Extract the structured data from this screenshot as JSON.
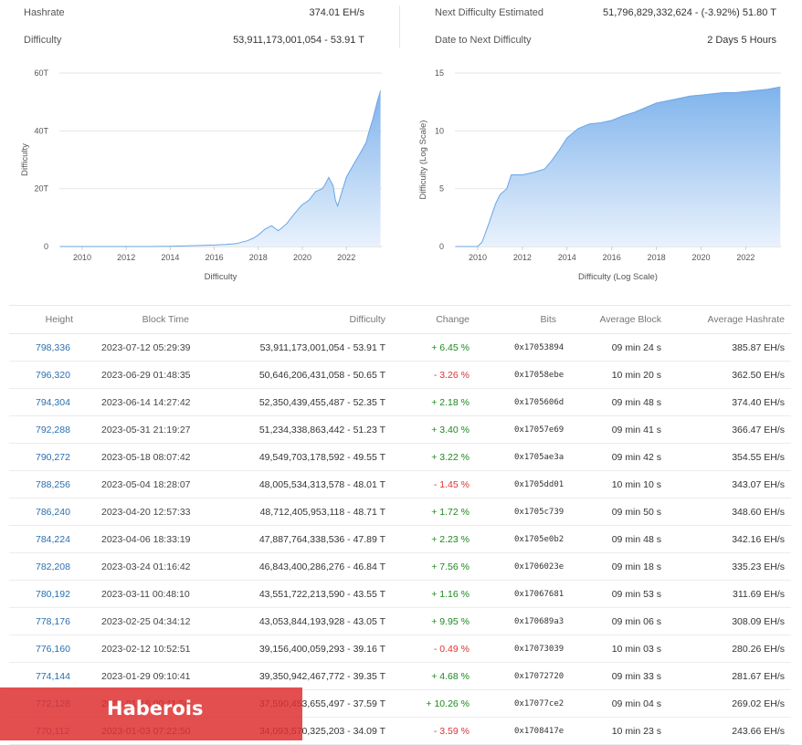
{
  "stats": {
    "hashrate_label": "Hashrate",
    "hashrate_value": "374.01 EH/s",
    "difficulty_label": "Difficulty",
    "difficulty_value": "53,911,173,001,054 - 53.91 T",
    "next_label": "Next Difficulty Estimated",
    "next_value": "51,796,829,332,624 - (-3.92%) 51.80 T",
    "date_label": "Date to Next Difficulty",
    "date_value": "2 Days 5 Hours"
  },
  "colors": {
    "fill_top": "#7fb3ec",
    "fill_bottom": "#e9f2fc",
    "line": "#6aa6e6",
    "link": "#2a6fb0",
    "positive": "#1a8a1a",
    "negative": "#dd3333",
    "watermark": "#de3030"
  },
  "chart_data": [
    {
      "type": "area",
      "xlabel": "Difficulty",
      "ylabel": "Difficulty",
      "xlim": [
        2009,
        2023.6
      ],
      "ylim": [
        0,
        60
      ],
      "x_ticks": [
        "2010",
        "2012",
        "2014",
        "2016",
        "2018",
        "2020",
        "2022"
      ],
      "y_ticks": [
        "0",
        "20T",
        "40T",
        "60T"
      ],
      "y_tick_values": [
        0,
        20,
        40,
        60
      ],
      "grid": true,
      "x": [
        2009,
        2010,
        2011,
        2012,
        2013,
        2014,
        2015,
        2016,
        2016.5,
        2017,
        2017.5,
        2017.8,
        2018,
        2018.3,
        2018.6,
        2018.9,
        2019,
        2019.3,
        2019.6,
        2019.9,
        2020,
        2020.3,
        2020.6,
        2020.9,
        2021,
        2021.2,
        2021.4,
        2021.5,
        2021.6,
        2021.8,
        2022,
        2022.3,
        2022.6,
        2022.9,
        2023,
        2023.2,
        2023.4,
        2023.55
      ],
      "values": [
        0,
        0,
        0,
        0,
        0.01,
        0.1,
        0.3,
        0.5,
        0.7,
        1,
        2,
        3,
        4,
        6,
        7.2,
        5.5,
        6,
        8,
        11,
        13.7,
        14.5,
        16,
        19,
        20,
        21,
        23.9,
        21,
        16,
        14,
        19,
        24,
        28,
        32,
        36,
        39,
        44,
        50,
        53.9
      ]
    },
    {
      "type": "area",
      "xlabel": "Difficulty (Log Scale)",
      "ylabel": "Difficulty (Log Scale)",
      "xlim": [
        2009,
        2023.6
      ],
      "ylim": [
        0,
        15
      ],
      "x_ticks": [
        "2010",
        "2012",
        "2014",
        "2016",
        "2018",
        "2020",
        "2022"
      ],
      "y_ticks": [
        "0",
        "5",
        "10",
        "15"
      ],
      "y_tick_values": [
        0,
        5,
        10,
        15
      ],
      "grid": true,
      "x": [
        2009,
        2009.5,
        2010,
        2010.2,
        2010.5,
        2010.8,
        2011,
        2011.3,
        2011.5,
        2012,
        2012.5,
        2013,
        2013.3,
        2013.6,
        2014,
        2014.5,
        2015,
        2015.5,
        2016,
        2016.5,
        2017,
        2017.5,
        2018,
        2018.5,
        2019,
        2019.5,
        2020,
        2020.5,
        2021,
        2021.5,
        2022,
        2022.5,
        2023,
        2023.55
      ],
      "values": [
        0,
        0,
        0,
        0.4,
        2,
        3.7,
        4.5,
        5,
        6.2,
        6.2,
        6.4,
        6.7,
        7.4,
        8.2,
        9.4,
        10.2,
        10.6,
        10.7,
        10.9,
        11.3,
        11.6,
        12,
        12.4,
        12.6,
        12.8,
        13,
        13.1,
        13.2,
        13.3,
        13.3,
        13.4,
        13.5,
        13.6,
        13.8
      ]
    }
  ],
  "table": {
    "columns": [
      "Height",
      "Block Time",
      "Difficulty",
      "Change",
      "Bits",
      "Average Block",
      "Average Hashrate"
    ],
    "rows": [
      {
        "height": "798,336",
        "time": "2023-07-12 05:29:39",
        "difficulty": "53,911,173,001,054 - 53.91 T",
        "change": "+ 6.45 %",
        "positive": true,
        "bits": "0x17053894",
        "avg_block": "09 min 24 s",
        "avg_hashrate": "385.87 EH/s"
      },
      {
        "height": "796,320",
        "time": "2023-06-29 01:48:35",
        "difficulty": "50,646,206,431,058 - 50.65 T",
        "change": "- 3.26 %",
        "positive": false,
        "bits": "0x17058ebe",
        "avg_block": "10 min 20 s",
        "avg_hashrate": "362.50 EH/s"
      },
      {
        "height": "794,304",
        "time": "2023-06-14 14:27:42",
        "difficulty": "52,350,439,455,487 - 52.35 T",
        "change": "+ 2.18 %",
        "positive": true,
        "bits": "0x1705606d",
        "avg_block": "09 min 48 s",
        "avg_hashrate": "374.40 EH/s"
      },
      {
        "height": "792,288",
        "time": "2023-05-31 21:19:27",
        "difficulty": "51,234,338,863,442 - 51.23 T",
        "change": "+ 3.40 %",
        "positive": true,
        "bits": "0x17057e69",
        "avg_block": "09 min 41 s",
        "avg_hashrate": "366.47 EH/s"
      },
      {
        "height": "790,272",
        "time": "2023-05-18 08:07:42",
        "difficulty": "49,549,703,178,592 - 49.55 T",
        "change": "+ 3.22 %",
        "positive": true,
        "bits": "0x1705ae3a",
        "avg_block": "09 min 42 s",
        "avg_hashrate": "354.55 EH/s"
      },
      {
        "height": "788,256",
        "time": "2023-05-04 18:28:07",
        "difficulty": "48,005,534,313,578 - 48.01 T",
        "change": "- 1.45 %",
        "positive": false,
        "bits": "0x1705dd01",
        "avg_block": "10 min 10 s",
        "avg_hashrate": "343.07 EH/s"
      },
      {
        "height": "786,240",
        "time": "2023-04-20 12:57:33",
        "difficulty": "48,712,405,953,118 - 48.71 T",
        "change": "+ 1.72 %",
        "positive": true,
        "bits": "0x1705c739",
        "avg_block": "09 min 50 s",
        "avg_hashrate": "348.60 EH/s"
      },
      {
        "height": "784,224",
        "time": "2023-04-06 18:33:19",
        "difficulty": "47,887,764,338,536 - 47.89 T",
        "change": "+ 2.23 %",
        "positive": true,
        "bits": "0x1705e0b2",
        "avg_block": "09 min 48 s",
        "avg_hashrate": "342.16 EH/s"
      },
      {
        "height": "782,208",
        "time": "2023-03-24 01:16:42",
        "difficulty": "46,843,400,286,276 - 46.84 T",
        "change": "+ 7.56 %",
        "positive": true,
        "bits": "0x1706023e",
        "avg_block": "09 min 18 s",
        "avg_hashrate": "335.23 EH/s"
      },
      {
        "height": "780,192",
        "time": "2023-03-11 00:48:10",
        "difficulty": "43,551,722,213,590 - 43.55 T",
        "change": "+ 1.16 %",
        "positive": true,
        "bits": "0x17067681",
        "avg_block": "09 min 53 s",
        "avg_hashrate": "311.69 EH/s"
      },
      {
        "height": "778,176",
        "time": "2023-02-25 04:34:12",
        "difficulty": "43,053,844,193,928 - 43.05 T",
        "change": "+ 9.95 %",
        "positive": true,
        "bits": "0x170689a3",
        "avg_block": "09 min 06 s",
        "avg_hashrate": "308.09 EH/s"
      },
      {
        "height": "776,160",
        "time": "2023-02-12 10:52:51",
        "difficulty": "39,156,400,059,293 - 39.16 T",
        "change": "- 0.49 %",
        "positive": false,
        "bits": "0x17073039",
        "avg_block": "10 min 03 s",
        "avg_hashrate": "280.26 EH/s"
      },
      {
        "height": "774,144",
        "time": "2023-01-29 09:10:41",
        "difficulty": "39,350,942,467,772 - 39.35 T",
        "change": "+ 4.68 %",
        "positive": true,
        "bits": "0x17072720",
        "avg_block": "09 min 33 s",
        "avg_hashrate": "281.67 EH/s"
      },
      {
        "height": "772,128",
        "time": "2023-01-16 00:11:50",
        "difficulty": "37,590,453,655,497 - 37.59 T",
        "change": "+ 10.26 %",
        "positive": true,
        "bits": "0x17077ce2",
        "avg_block": "09 min 04 s",
        "avg_hashrate": "269.02 EH/s"
      },
      {
        "height": "770,112",
        "time": "2023-01-03 07:22:50",
        "difficulty": "34,093,570,325,203 - 34.09 T",
        "change": "- 3.59 %",
        "positive": false,
        "bits": "0x1708417e",
        "avg_block": "10 min 23 s",
        "avg_hashrate": "243.66 EH/s"
      }
    ]
  },
  "watermark": {
    "text": "Haberois"
  }
}
